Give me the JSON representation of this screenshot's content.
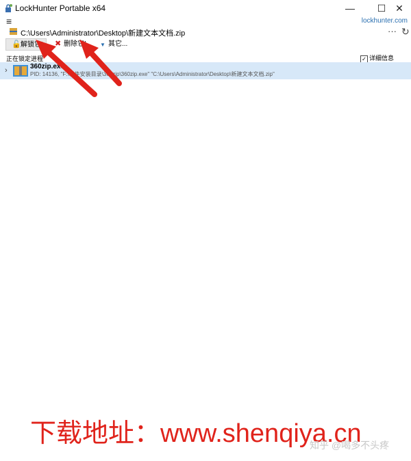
{
  "window": {
    "title": "LockHunter Portable x64",
    "site_link": "lockhunter.com",
    "minimize_icon": "—",
    "maximize_icon": "☐",
    "close_icon": "✕"
  },
  "path": {
    "value": "C:\\Users\\Administrator\\Desktop\\新建文本文档.zip"
  },
  "toolbar": {
    "unlock_label": "解锁它!",
    "delete_label": "删除它!",
    "other_label": "其它...",
    "more_glyph": "···",
    "refresh_glyph": "↻"
  },
  "list": {
    "header": "正在锁定进程",
    "details_label": "详细信息",
    "details_checked": true,
    "rows": [
      {
        "name": "360zip.exe",
        "info": "PID: 14136, \"F:\\软件安装目录\\360zip\\360zip.exe\" \"C:\\Users\\Administrator\\Desktop\\新建文本文档.zip\""
      }
    ]
  },
  "overlay": {
    "watermark": "下载地址：www.shenqiya.cn",
    "credit": "知乎 @喝多不头疼",
    "arrow_color": "#e0231b",
    "watermark_color": "#e0231b"
  }
}
